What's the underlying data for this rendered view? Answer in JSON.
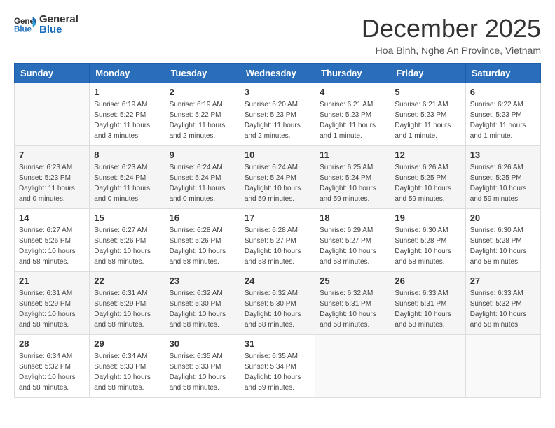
{
  "header": {
    "logo_general": "General",
    "logo_blue": "Blue",
    "month": "December 2025",
    "location": "Hoa Binh, Nghe An Province, Vietnam"
  },
  "weekdays": [
    "Sunday",
    "Monday",
    "Tuesday",
    "Wednesday",
    "Thursday",
    "Friday",
    "Saturday"
  ],
  "weeks": [
    [
      {
        "day": "",
        "sunrise": "",
        "sunset": "",
        "daylight": ""
      },
      {
        "day": "1",
        "sunrise": "Sunrise: 6:19 AM",
        "sunset": "Sunset: 5:22 PM",
        "daylight": "Daylight: 11 hours and 3 minutes."
      },
      {
        "day": "2",
        "sunrise": "Sunrise: 6:19 AM",
        "sunset": "Sunset: 5:22 PM",
        "daylight": "Daylight: 11 hours and 2 minutes."
      },
      {
        "day": "3",
        "sunrise": "Sunrise: 6:20 AM",
        "sunset": "Sunset: 5:23 PM",
        "daylight": "Daylight: 11 hours and 2 minutes."
      },
      {
        "day": "4",
        "sunrise": "Sunrise: 6:21 AM",
        "sunset": "Sunset: 5:23 PM",
        "daylight": "Daylight: 11 hours and 1 minute."
      },
      {
        "day": "5",
        "sunrise": "Sunrise: 6:21 AM",
        "sunset": "Sunset: 5:23 PM",
        "daylight": "Daylight: 11 hours and 1 minute."
      },
      {
        "day": "6",
        "sunrise": "Sunrise: 6:22 AM",
        "sunset": "Sunset: 5:23 PM",
        "daylight": "Daylight: 11 hours and 1 minute."
      }
    ],
    [
      {
        "day": "7",
        "sunrise": "Sunrise: 6:23 AM",
        "sunset": "Sunset: 5:23 PM",
        "daylight": "Daylight: 11 hours and 0 minutes."
      },
      {
        "day": "8",
        "sunrise": "Sunrise: 6:23 AM",
        "sunset": "Sunset: 5:24 PM",
        "daylight": "Daylight: 11 hours and 0 minutes."
      },
      {
        "day": "9",
        "sunrise": "Sunrise: 6:24 AM",
        "sunset": "Sunset: 5:24 PM",
        "daylight": "Daylight: 11 hours and 0 minutes."
      },
      {
        "day": "10",
        "sunrise": "Sunrise: 6:24 AM",
        "sunset": "Sunset: 5:24 PM",
        "daylight": "Daylight: 10 hours and 59 minutes."
      },
      {
        "day": "11",
        "sunrise": "Sunrise: 6:25 AM",
        "sunset": "Sunset: 5:24 PM",
        "daylight": "Daylight: 10 hours and 59 minutes."
      },
      {
        "day": "12",
        "sunrise": "Sunrise: 6:26 AM",
        "sunset": "Sunset: 5:25 PM",
        "daylight": "Daylight: 10 hours and 59 minutes."
      },
      {
        "day": "13",
        "sunrise": "Sunrise: 6:26 AM",
        "sunset": "Sunset: 5:25 PM",
        "daylight": "Daylight: 10 hours and 59 minutes."
      }
    ],
    [
      {
        "day": "14",
        "sunrise": "Sunrise: 6:27 AM",
        "sunset": "Sunset: 5:26 PM",
        "daylight": "Daylight: 10 hours and 58 minutes."
      },
      {
        "day": "15",
        "sunrise": "Sunrise: 6:27 AM",
        "sunset": "Sunset: 5:26 PM",
        "daylight": "Daylight: 10 hours and 58 minutes."
      },
      {
        "day": "16",
        "sunrise": "Sunrise: 6:28 AM",
        "sunset": "Sunset: 5:26 PM",
        "daylight": "Daylight: 10 hours and 58 minutes."
      },
      {
        "day": "17",
        "sunrise": "Sunrise: 6:28 AM",
        "sunset": "Sunset: 5:27 PM",
        "daylight": "Daylight: 10 hours and 58 minutes."
      },
      {
        "day": "18",
        "sunrise": "Sunrise: 6:29 AM",
        "sunset": "Sunset: 5:27 PM",
        "daylight": "Daylight: 10 hours and 58 minutes."
      },
      {
        "day": "19",
        "sunrise": "Sunrise: 6:30 AM",
        "sunset": "Sunset: 5:28 PM",
        "daylight": "Daylight: 10 hours and 58 minutes."
      },
      {
        "day": "20",
        "sunrise": "Sunrise: 6:30 AM",
        "sunset": "Sunset: 5:28 PM",
        "daylight": "Daylight: 10 hours and 58 minutes."
      }
    ],
    [
      {
        "day": "21",
        "sunrise": "Sunrise: 6:31 AM",
        "sunset": "Sunset: 5:29 PM",
        "daylight": "Daylight: 10 hours and 58 minutes."
      },
      {
        "day": "22",
        "sunrise": "Sunrise: 6:31 AM",
        "sunset": "Sunset: 5:29 PM",
        "daylight": "Daylight: 10 hours and 58 minutes."
      },
      {
        "day": "23",
        "sunrise": "Sunrise: 6:32 AM",
        "sunset": "Sunset: 5:30 PM",
        "daylight": "Daylight: 10 hours and 58 minutes."
      },
      {
        "day": "24",
        "sunrise": "Sunrise: 6:32 AM",
        "sunset": "Sunset: 5:30 PM",
        "daylight": "Daylight: 10 hours and 58 minutes."
      },
      {
        "day": "25",
        "sunrise": "Sunrise: 6:32 AM",
        "sunset": "Sunset: 5:31 PM",
        "daylight": "Daylight: 10 hours and 58 minutes."
      },
      {
        "day": "26",
        "sunrise": "Sunrise: 6:33 AM",
        "sunset": "Sunset: 5:31 PM",
        "daylight": "Daylight: 10 hours and 58 minutes."
      },
      {
        "day": "27",
        "sunrise": "Sunrise: 6:33 AM",
        "sunset": "Sunset: 5:32 PM",
        "daylight": "Daylight: 10 hours and 58 minutes."
      }
    ],
    [
      {
        "day": "28",
        "sunrise": "Sunrise: 6:34 AM",
        "sunset": "Sunset: 5:32 PM",
        "daylight": "Daylight: 10 hours and 58 minutes."
      },
      {
        "day": "29",
        "sunrise": "Sunrise: 6:34 AM",
        "sunset": "Sunset: 5:33 PM",
        "daylight": "Daylight: 10 hours and 58 minutes."
      },
      {
        "day": "30",
        "sunrise": "Sunrise: 6:35 AM",
        "sunset": "Sunset: 5:33 PM",
        "daylight": "Daylight: 10 hours and 58 minutes."
      },
      {
        "day": "31",
        "sunrise": "Sunrise: 6:35 AM",
        "sunset": "Sunset: 5:34 PM",
        "daylight": "Daylight: 10 hours and 59 minutes."
      },
      {
        "day": "",
        "sunrise": "",
        "sunset": "",
        "daylight": ""
      },
      {
        "day": "",
        "sunrise": "",
        "sunset": "",
        "daylight": ""
      },
      {
        "day": "",
        "sunrise": "",
        "sunset": "",
        "daylight": ""
      }
    ]
  ]
}
